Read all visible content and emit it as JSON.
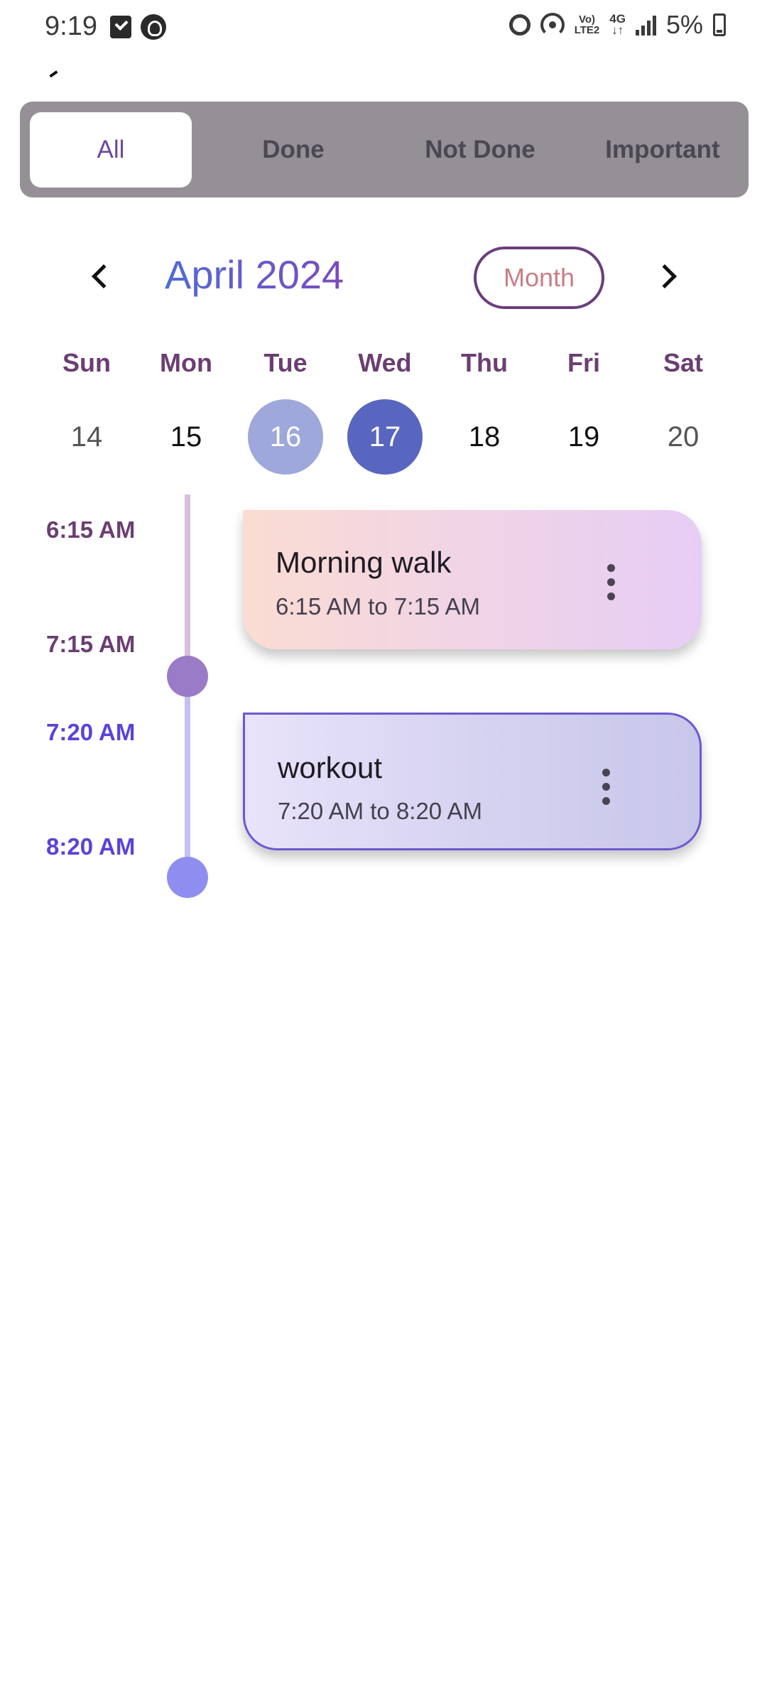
{
  "status_bar": {
    "time": "9:19",
    "volte_line1": "Vo)",
    "volte_line2": "LTE2",
    "network_line1": "4G",
    "network_line2": "↓↑",
    "battery": "5%"
  },
  "filters": [
    {
      "label": "All",
      "active": true
    },
    {
      "label": "Done",
      "active": false
    },
    {
      "label": "Not Done",
      "active": false
    },
    {
      "label": "Important",
      "active": false
    }
  ],
  "calendar": {
    "month_title": "April 2024",
    "view_toggle": "Month",
    "days": [
      {
        "name": "Sun",
        "date": "14"
      },
      {
        "name": "Mon",
        "date": "15"
      },
      {
        "name": "Tue",
        "date": "16"
      },
      {
        "name": "Wed",
        "date": "17"
      },
      {
        "name": "Thu",
        "date": "18"
      },
      {
        "name": "Fri",
        "date": "19"
      },
      {
        "name": "Sat",
        "date": "20"
      }
    ]
  },
  "tasks": [
    {
      "title": "Morning walk",
      "time_range": "6:15 AM to 7:15 AM",
      "start": "6:15 AM",
      "end": "7:15 AM"
    },
    {
      "title": "workout",
      "time_range": "7:20 AM to 8:20 AM",
      "start": "7:20 AM",
      "end": "8:20 AM"
    }
  ],
  "colors": {
    "accent_purple": "#6b3e72",
    "selected_day": "#5966c0",
    "today_day": "#9ea8da",
    "timeline_purple": "#9a7bc7",
    "timeline_blue": "#8e8ef0"
  }
}
